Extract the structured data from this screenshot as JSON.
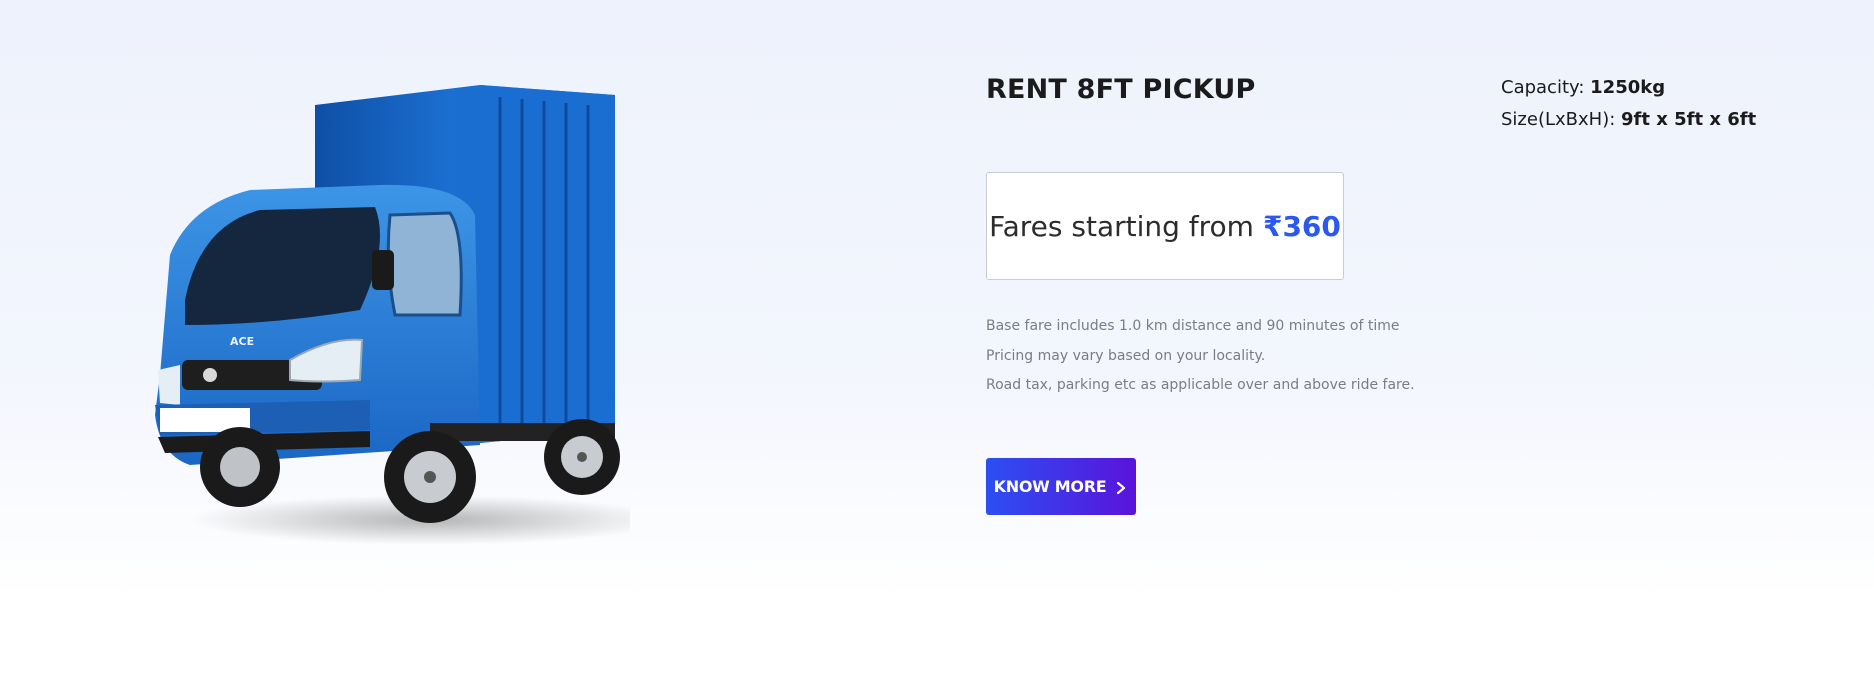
{
  "vehicle": {
    "title": "RENT 8FT PICKUP",
    "image_alt": "Tata Ace blue covered pickup truck",
    "badge_text": "ACE",
    "specs": {
      "capacity_label": "Capacity:",
      "capacity_value": "1250kg",
      "size_label": "Size(LxBxH):",
      "size_value": "9ft x 5ft x 6ft"
    }
  },
  "fare": {
    "prefix": "Fares starting from",
    "price": "₹360"
  },
  "notes": [
    "Base fare includes 1.0 km distance and 90 minutes of time",
    "Pricing may vary based on your locality.",
    "Road tax, parking etc as applicable over and above ride fare."
  ],
  "cta": {
    "label": "KNOW MORE",
    "icon": "chevron-right-icon"
  },
  "colors": {
    "accent": "#2b59f0",
    "button_start": "#2c4ff2",
    "button_end": "#5a13dc",
    "truck_body": "#2a7fd6",
    "truck_box": "#1565c8"
  }
}
